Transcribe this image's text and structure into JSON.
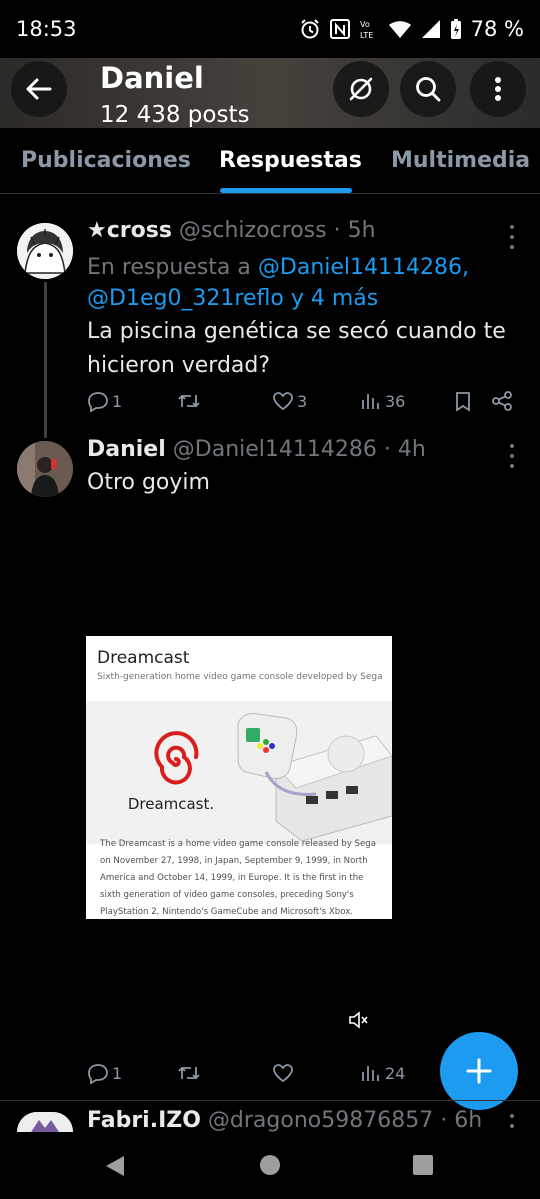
{
  "status_bar": {
    "time": "18:53",
    "battery": "78 %"
  },
  "header": {
    "title": "Daniel",
    "posts": "12 438 posts"
  },
  "tabs": [
    {
      "label": "Publicaciones"
    },
    {
      "label": "Respuestas"
    },
    {
      "label": "Multimedia"
    }
  ],
  "tweets": [
    {
      "name": "★𝗰𝗿𝗼𝘀𝘀",
      "handle": "@schizocross",
      "time": "· 5h",
      "reply_prefix": "En respuesta a ",
      "reply_link1": "@Daniel14114286,",
      "reply_link2": "@D1eg0_321reflo y 4 más",
      "text": "La piscina genética se secó cuando te hicieron verdad?",
      "replies": "1",
      "retweets": "",
      "likes": "3",
      "views": "36"
    },
    {
      "name": "Daniel",
      "handle": "@Daniel14114286",
      "time": "· 4h",
      "text": "Otro goyim",
      "replies": "1",
      "retweets": "",
      "likes": "",
      "views": "24",
      "media": {
        "title": "Dreamcast",
        "subtitle": "Sixth-generation home video game console developed by Sega",
        "logo_text": "Dreamcast.",
        "description": "The Dreamcast is a home video game console released by Sega on November 27, 1998, in Japan, September 9, 1999, in North America and October 14, 1999, in Europe. It is the first in the sixth generation of video game consoles, preceding Sony's PlayStation 2, Nintendo's GameCube and Microsoft's Xbox. Wikipedia"
      }
    },
    {
      "name": "Fabri.IZO",
      "handle": "@dragono59876857",
      "time": "· 6h"
    }
  ],
  "colors": {
    "accent": "#1d9bf0",
    "background": "#000000",
    "muted": "#71767b"
  }
}
